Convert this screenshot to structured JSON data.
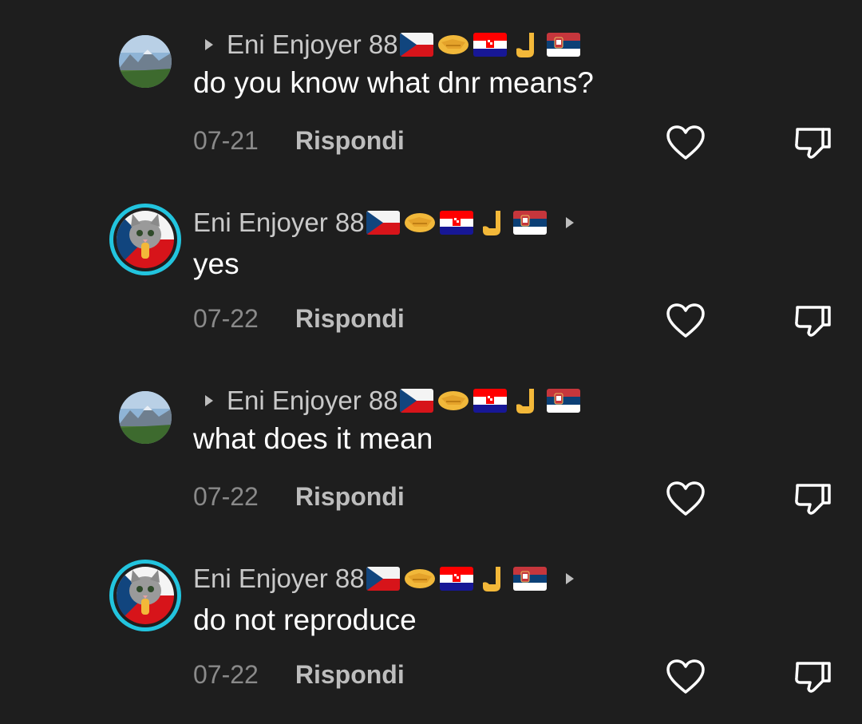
{
  "comments": [
    {
      "author": "Eni Enjoyer 88",
      "text": "do you know what dnr means?",
      "date": "07-21",
      "reply_label": "Rispondi",
      "avatar": "landscape-avatar",
      "caret_position": "before"
    },
    {
      "author": "Eni Enjoyer 88",
      "text": "yes",
      "date": "07-22",
      "reply_label": "Rispondi",
      "avatar": "cat-flag-avatar",
      "caret_position": "after"
    },
    {
      "author": "Eni Enjoyer 88",
      "text": "what does it mean",
      "date": "07-22",
      "reply_label": "Rispondi",
      "avatar": "landscape-avatar",
      "caret_position": "before"
    },
    {
      "author": "Eni Enjoyer 88",
      "text": "do not reproduce",
      "date": "07-22",
      "reply_label": "Rispondi",
      "avatar": "cat-flag-avatar",
      "caret_position": "after"
    }
  ],
  "name_emojis": [
    "czech-flag",
    "handshake",
    "croatia-flag",
    "hand-gesture",
    "serbia-flag"
  ],
  "colors": {
    "background": "#1e1e1e",
    "avatar_ring": "#22c4de",
    "username": "#c9c9c9",
    "date": "#8a8a8a"
  }
}
